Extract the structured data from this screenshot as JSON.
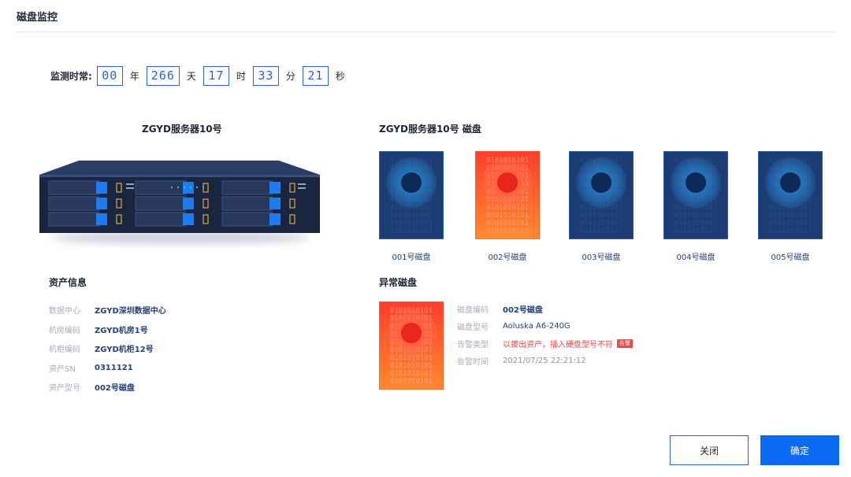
{
  "page_title": "磁盘监控",
  "monitor": {
    "label": "监测时常:",
    "segments": [
      {
        "value": "00",
        "unit": "年"
      },
      {
        "value": "266",
        "unit": "天"
      },
      {
        "value": "17",
        "unit": "时"
      },
      {
        "value": "33",
        "unit": "分"
      },
      {
        "value": "21",
        "unit": "秒"
      }
    ]
  },
  "server": {
    "title": "ZGYD服务器10号"
  },
  "disks_section": {
    "title": "ZGYD服务器10号 磁盘",
    "disks": [
      {
        "label": "001号磁盘",
        "status": "normal"
      },
      {
        "label": "002号磁盘",
        "status": "alert"
      },
      {
        "label": "003号磁盘",
        "status": "normal"
      },
      {
        "label": "004号磁盘",
        "status": "normal"
      },
      {
        "label": "005号磁盘",
        "status": "normal"
      }
    ],
    "binary_text": "0101010101"
  },
  "asset_info": {
    "title": "资产信息",
    "rows": [
      {
        "key": "数据中心",
        "value": "ZGYD深圳数据中心"
      },
      {
        "key": "机房编码",
        "value": "ZGYD机房1号"
      },
      {
        "key": "机柜编码",
        "value": "ZGYD机柜12号"
      },
      {
        "key": "资产SN",
        "value": "0311121"
      },
      {
        "key": "资产型号",
        "value": "002号磁盘"
      }
    ]
  },
  "abnormal": {
    "title": "异常磁盘",
    "code_key": "磁盘编码",
    "code_value": "002号磁盘",
    "model_key": "磁盘型号",
    "model_value": "Aoluska A6-240G",
    "type_key": "告警类型",
    "type_value": "以拔出资产，插入硬盘型号不符",
    "type_badge": "告警",
    "time_key": "告警时间",
    "time_value": "2021/07/25  22:21:12"
  },
  "buttons": {
    "close": "关闭",
    "ok": "确定"
  },
  "colors": {
    "accent": "#2a63d9",
    "primary": "#0a6cf5",
    "alert": "#f0484a",
    "disk_normal": "#1c3d74",
    "disk_alert": "#ff4a2b"
  }
}
